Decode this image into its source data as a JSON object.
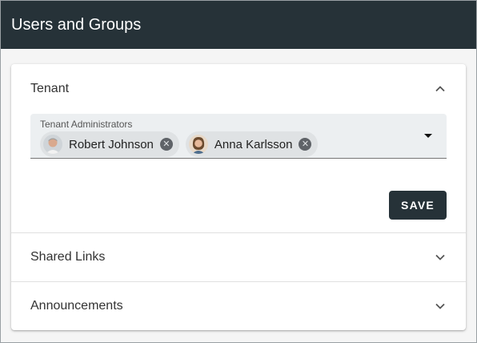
{
  "header": {
    "title": "Users and Groups"
  },
  "panels": {
    "tenant": {
      "title": "Tenant",
      "expanded": true,
      "field_label": "Tenant Administrators",
      "chips": [
        {
          "name": "Robert Johnson",
          "avatar": "avatar-robert"
        },
        {
          "name": "Anna Karlsson",
          "avatar": "avatar-anna"
        }
      ],
      "save_label": "SAVE"
    },
    "shared_links": {
      "title": "Shared Links",
      "expanded": false
    },
    "announcements": {
      "title": "Announcements",
      "expanded": false
    }
  },
  "colors": {
    "header_bg": "#263238",
    "button_bg": "#263238",
    "field_bg": "#eceff1",
    "chip_bg": "#dfe2e4"
  }
}
